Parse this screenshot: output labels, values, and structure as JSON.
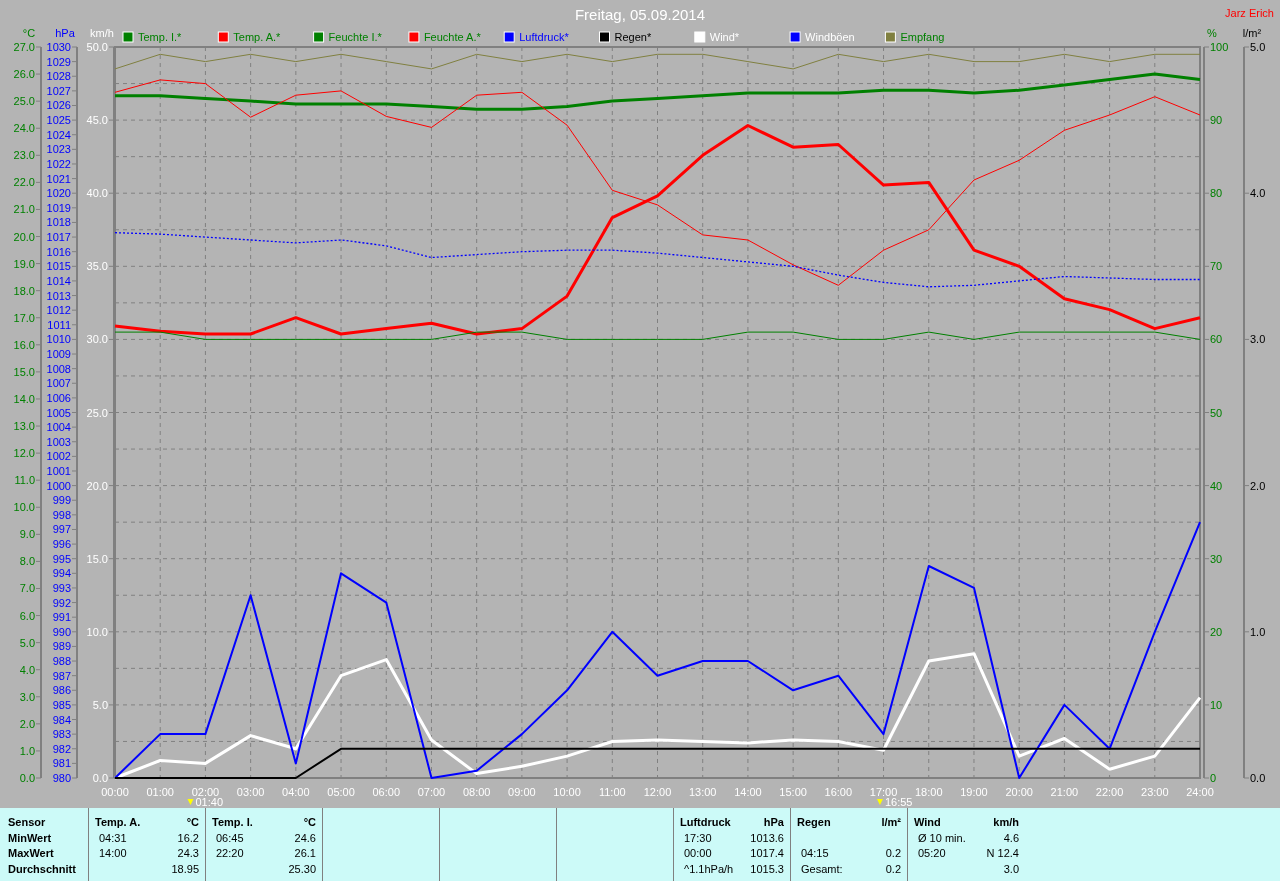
{
  "header": {
    "title": "Freitag, 05.09.2014",
    "user": "Jarz Erich"
  },
  "chart": {
    "chart_data": {
      "type": "line",
      "x": [
        0,
        1,
        2,
        3,
        4,
        5,
        6,
        7,
        8,
        9,
        10,
        11,
        12,
        13,
        14,
        15,
        16,
        17,
        18,
        19,
        20,
        21,
        22,
        23,
        24
      ],
      "xlim": [
        0,
        24
      ],
      "ylim": [
        0,
        50
      ],
      "y2lim": [
        0,
        100
      ],
      "y3lim": [
        0,
        27
      ],
      "ylabel": "km/h",
      "y2label": "%",
      "y3label": "°C",
      "grid": true,
      "legend": "top",
      "xticks": [
        {
          "value": 0,
          "label": "00:00"
        },
        {
          "value": 1,
          "label": "01:00"
        },
        {
          "value": 2,
          "label": "02:00"
        },
        {
          "value": 3,
          "label": "03:00"
        },
        {
          "value": 4,
          "label": "04:00"
        },
        {
          "value": 5,
          "label": "05:00"
        },
        {
          "value": 6,
          "label": "06:00"
        },
        {
          "value": 7,
          "label": "07:00"
        },
        {
          "value": 8,
          "label": "08:00"
        },
        {
          "value": 9,
          "label": "09:00"
        },
        {
          "value": 10,
          "label": "10:00"
        },
        {
          "value": 11,
          "label": "11:00"
        },
        {
          "value": 12,
          "label": "12:00"
        },
        {
          "value": 13,
          "label": "13:00"
        },
        {
          "value": 14,
          "label": "14:00"
        },
        {
          "value": 15,
          "label": "15:00"
        },
        {
          "value": 16,
          "label": "16:00"
        },
        {
          "value": 17,
          "label": "17:00"
        },
        {
          "value": 18,
          "label": "18:00"
        },
        {
          "value": 19,
          "label": "19:00"
        },
        {
          "value": 20,
          "label": "20:00"
        },
        {
          "value": 21,
          "label": "21:00"
        },
        {
          "value": 22,
          "label": "22:00"
        },
        {
          "value": 23,
          "label": "23:00"
        },
        {
          "value": 24,
          "label": "24:00"
        }
      ],
      "yticks": [
        {
          "value": 50,
          "label": "50.0"
        },
        {
          "value": 45,
          "label": "45.0"
        },
        {
          "value": 40,
          "label": "40.0"
        },
        {
          "value": 35,
          "label": "35.0"
        },
        {
          "value": 30,
          "label": "30.0"
        },
        {
          "value": 25,
          "label": "25.0"
        },
        {
          "value": 20,
          "label": "20.0"
        },
        {
          "value": 15,
          "label": "15.0"
        },
        {
          "value": 10,
          "label": "10.0"
        },
        {
          "value": 5,
          "label": "5.0"
        },
        {
          "value": 0,
          "label": "0.0"
        }
      ],
      "y2ticks": [
        100,
        90,
        80,
        70,
        60,
        50,
        40,
        30,
        20,
        10,
        0
      ],
      "y3ticks": [
        {
          "value": 27,
          "label": "27.0"
        },
        {
          "value": 26,
          "label": "26.0"
        },
        {
          "value": 25,
          "label": "25.0"
        },
        {
          "value": 24,
          "label": "24.0"
        },
        {
          "value": 23,
          "label": "23.0"
        },
        {
          "value": 22,
          "label": "22.0"
        },
        {
          "value": 21,
          "label": "21.0"
        },
        {
          "value": 20,
          "label": "20.0"
        },
        {
          "value": 19,
          "label": "19.0"
        },
        {
          "value": 18,
          "label": "18.0"
        },
        {
          "value": 17,
          "label": "17.0"
        },
        {
          "value": 16,
          "label": "16.0"
        },
        {
          "value": 15,
          "label": "15.0"
        },
        {
          "value": 14,
          "label": "14.0"
        },
        {
          "value": 13,
          "label": "13.0"
        },
        {
          "value": 12,
          "label": "12.0"
        },
        {
          "value": 11,
          "label": "11.0"
        },
        {
          "value": 10,
          "label": "10.0"
        },
        {
          "value": 9,
          "label": "9.0"
        },
        {
          "value": 8,
          "label": "8.0"
        },
        {
          "value": 7,
          "label": "7.0"
        },
        {
          "value": 6,
          "label": "6.0"
        },
        {
          "value": 5,
          "label": "5.0"
        },
        {
          "value": 4,
          "label": "4.0"
        },
        {
          "value": 3,
          "label": "3.0"
        },
        {
          "value": 2,
          "label": "2.0"
        },
        {
          "value": 1,
          "label": "1.0"
        },
        {
          "value": 0,
          "label": "0.0"
        }
      ],
      "series": [
        {
          "name": "Temp. I.*",
          "color": "#008000",
          "axis": "y3",
          "values": [
            25.2,
            25.2,
            25.1,
            25.0,
            24.9,
            24.9,
            24.9,
            24.8,
            24.7,
            24.7,
            24.8,
            25.0,
            25.1,
            25.2,
            25.3,
            25.3,
            25.3,
            25.4,
            25.4,
            25.3,
            25.4,
            25.6,
            25.8,
            26.0,
            25.8
          ]
        },
        {
          "name": "Temp. A.*",
          "color": "#ff0000",
          "axis": "y3",
          "values": [
            16.7,
            16.5,
            16.4,
            16.4,
            17.0,
            16.4,
            16.6,
            16.8,
            16.4,
            16.6,
            17.8,
            20.7,
            21.5,
            23.0,
            24.1,
            23.3,
            23.4,
            21.9,
            22.0,
            19.5,
            18.9,
            17.7,
            17.3,
            16.6,
            17.0
          ]
        },
        {
          "name": "Feuchte I.*",
          "color": "#008000",
          "axis": "y2",
          "values": [
            61,
            61,
            60,
            60,
            60,
            60,
            60,
            60,
            61,
            61,
            60,
            60,
            60,
            60,
            61,
            61,
            60,
            60,
            61,
            60,
            61,
            61,
            61,
            61,
            60
          ]
        },
        {
          "name": "Feuchte A.*",
          "color": "#ff0000",
          "axis": "y2",
          "values": [
            93.8,
            95.5,
            95,
            90.4,
            93.4,
            94,
            90.5,
            89,
            93.4,
            93.8,
            89.3,
            80.4,
            78.4,
            74.3,
            73.6,
            70.2,
            67.4,
            72.2,
            75,
            81.8,
            84.5,
            88.6,
            90.7,
            93.2,
            90.7
          ]
        },
        {
          "name": "Wind*",
          "color": "#ffffff",
          "values": [
            0,
            1.2,
            1.0,
            2.9,
            2.0,
            7.0,
            8.1,
            2.6,
            0.3,
            0.8,
            1.5,
            2.5,
            2.6,
            2.5,
            2.4,
            2.6,
            2.5,
            1.9,
            8.0,
            8.5,
            1.5,
            2.7,
            0.6,
            1.5,
            5.5
          ]
        },
        {
          "name": "Windböen",
          "color": "#0000ff",
          "values": [
            0,
            3.0,
            3.0,
            12.5,
            1.0,
            14.0,
            12.0,
            0,
            0.5,
            3.0,
            6.0,
            10.0,
            7.0,
            8.0,
            8.0,
            6.0,
            7.0,
            3.0,
            14.5,
            13.0,
            0,
            5.0,
            2.0,
            10.0,
            17.5
          ]
        },
        {
          "name": "Empfang",
          "color": "#808040",
          "axis": "y2",
          "values": [
            97,
            99,
            98,
            99,
            98,
            99,
            98,
            97,
            99,
            98,
            99,
            98,
            99,
            99,
            98,
            97,
            99,
            98,
            99,
            98,
            98,
            99,
            98,
            99,
            99
          ]
        }
      ],
      "annotations": [
        "01:40",
        "16:55"
      ]
    }
  },
  "overlay": {
    "chart_data": {
      "type": "line",
      "x": [
        0,
        1,
        2,
        3,
        4,
        5,
        6,
        7,
        8,
        9,
        10,
        11,
        12,
        13,
        14,
        15,
        16,
        17,
        18,
        19,
        20,
        21,
        22,
        23,
        24
      ],
      "xlim": [
        0,
        24
      ],
      "ylim": [
        980,
        1030
      ],
      "y2lim": [
        0,
        5
      ],
      "ylabel": "hPa",
      "y2label": "l/m²",
      "yticks": [
        1030,
        1029,
        1028,
        1027,
        1026,
        1025,
        1024,
        1023,
        1022,
        1021,
        1020,
        1019,
        1018,
        1017,
        1016,
        1015,
        1014,
        1013,
        1012,
        1011,
        1010,
        1009,
        1008,
        1007,
        1006,
        1005,
        1004,
        1003,
        1002,
        1001,
        1000,
        999,
        998,
        997,
        996,
        995,
        994,
        993,
        992,
        991,
        990,
        989,
        988,
        987,
        986,
        985,
        984,
        983,
        982,
        981,
        980
      ],
      "y2ticks": [
        {
          "value": 5,
          "label": "5.0"
        },
        {
          "value": 4,
          "label": "4.0"
        },
        {
          "value": 3,
          "label": "3.0"
        },
        {
          "value": 2,
          "label": "2.0"
        },
        {
          "value": 1,
          "label": "1.0"
        },
        {
          "value": 0,
          "label": "0.0"
        }
      ],
      "series": [
        {
          "name": "Luftdruck*",
          "color": "#0000ff",
          "line_style": "dotted",
          "values": [
            1017.3,
            1017.2,
            1017.0,
            1016.8,
            1016.6,
            1016.8,
            1016.4,
            1015.6,
            1015.8,
            1016.0,
            1016.1,
            1016.1,
            1015.9,
            1015.6,
            1015.3,
            1015.0,
            1014.4,
            1013.9,
            1013.6,
            1013.7,
            1014.0,
            1014.3,
            1014.2,
            1014.1,
            1014.1
          ]
        },
        {
          "name": "Regen*",
          "color": "#000000",
          "axis": "y2",
          "values": [
            0,
            0,
            0,
            0,
            0,
            0.2,
            0.2,
            0.2,
            0.2,
            0.2,
            0.2,
            0.2,
            0.2,
            0.2,
            0.2,
            0.2,
            0.2,
            0.2,
            0.2,
            0.2,
            0.2,
            0.2,
            0.2,
            0.2,
            0.2
          ]
        }
      ]
    }
  },
  "stats": [
    {
      "kind": "labels",
      "lines": [
        "Sensor",
        "MinWert",
        "MaxWert",
        "Durchschnitt"
      ]
    },
    {
      "kind": "sensor",
      "header": "Temp. A.",
      "unit": "°C",
      "rows": [
        {
          "time": "04:31",
          "value": "16.2"
        },
        {
          "time": "14:00",
          "value": "24.3"
        },
        {
          "value": "18.95"
        }
      ]
    },
    {
      "kind": "sensor",
      "header": "Temp. I.",
      "unit": "°C",
      "rows": [
        {
          "time": "06:45",
          "value": "24.6"
        },
        {
          "time": "22:20",
          "value": "26.1"
        },
        {
          "value": "25.30"
        }
      ]
    },
    {
      "kind": "empty"
    },
    {
      "kind": "empty"
    },
    {
      "kind": "empty"
    },
    {
      "kind": "sensor",
      "header": "Luftdruck",
      "unit": "hPa",
      "rows": [
        {
          "time": "17:30",
          "value": "1013.6"
        },
        {
          "time": "00:00",
          "value": "1017.4"
        },
        {
          "time": "^1.1hPa/h",
          "value": "1015.3"
        }
      ]
    },
    {
      "kind": "sensor",
      "header": "Regen",
      "unit": "l/m²",
      "rows": [
        {},
        {
          "time": "04:15",
          "value": "0.2"
        },
        {
          "time": "Gesamt:",
          "value": "0.2"
        }
      ]
    },
    {
      "kind": "sensor",
      "header": "Wind",
      "unit": "km/h",
      "rows": [
        {
          "time": "Ø 10 min.",
          "value": "4.6"
        },
        {
          "time": "05:20",
          "value": "N 12.4"
        },
        {
          "value": "3.0"
        }
      ]
    }
  ]
}
